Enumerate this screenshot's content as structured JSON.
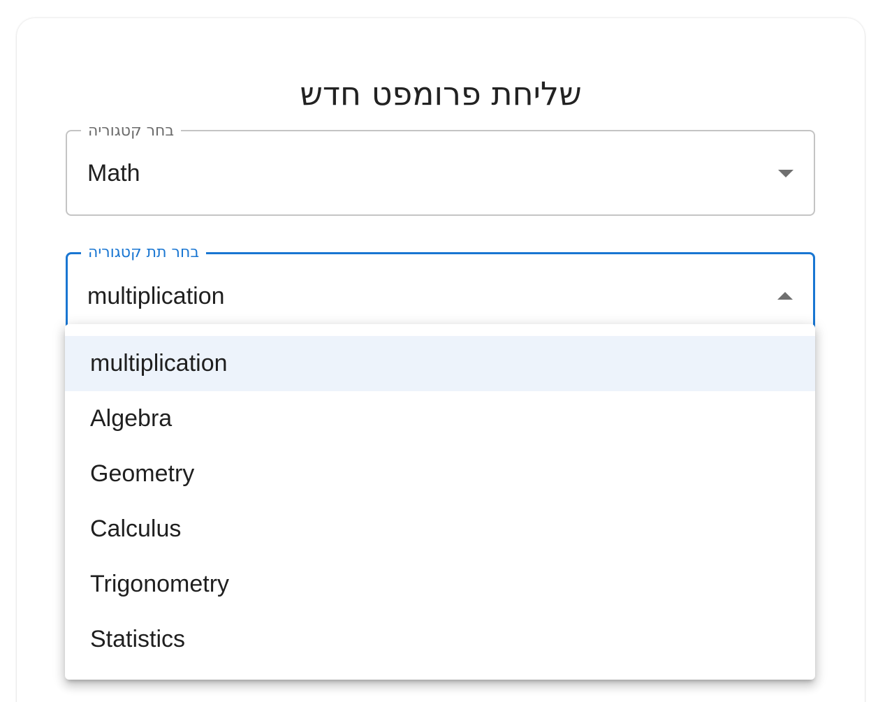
{
  "form": {
    "title": "שליחת פרומפט חדש"
  },
  "category": {
    "label": "בחר קטגוריה",
    "value": "Math"
  },
  "subcategory": {
    "label": "בחר תת קטגוריה",
    "value": "multiplication",
    "options": [
      "multiplication",
      "Algebra",
      "Geometry",
      "Calculus",
      "Trigonometry",
      "Statistics"
    ],
    "selected_index": 0
  },
  "colors": {
    "focus_accent": "#1976d2",
    "selected_option_bg": "#edf3fb",
    "idle_border": "#c4c4c4"
  },
  "icons": {
    "category_arrow": "chevron-down-icon",
    "subcategory_arrow": "chevron-up-icon"
  }
}
